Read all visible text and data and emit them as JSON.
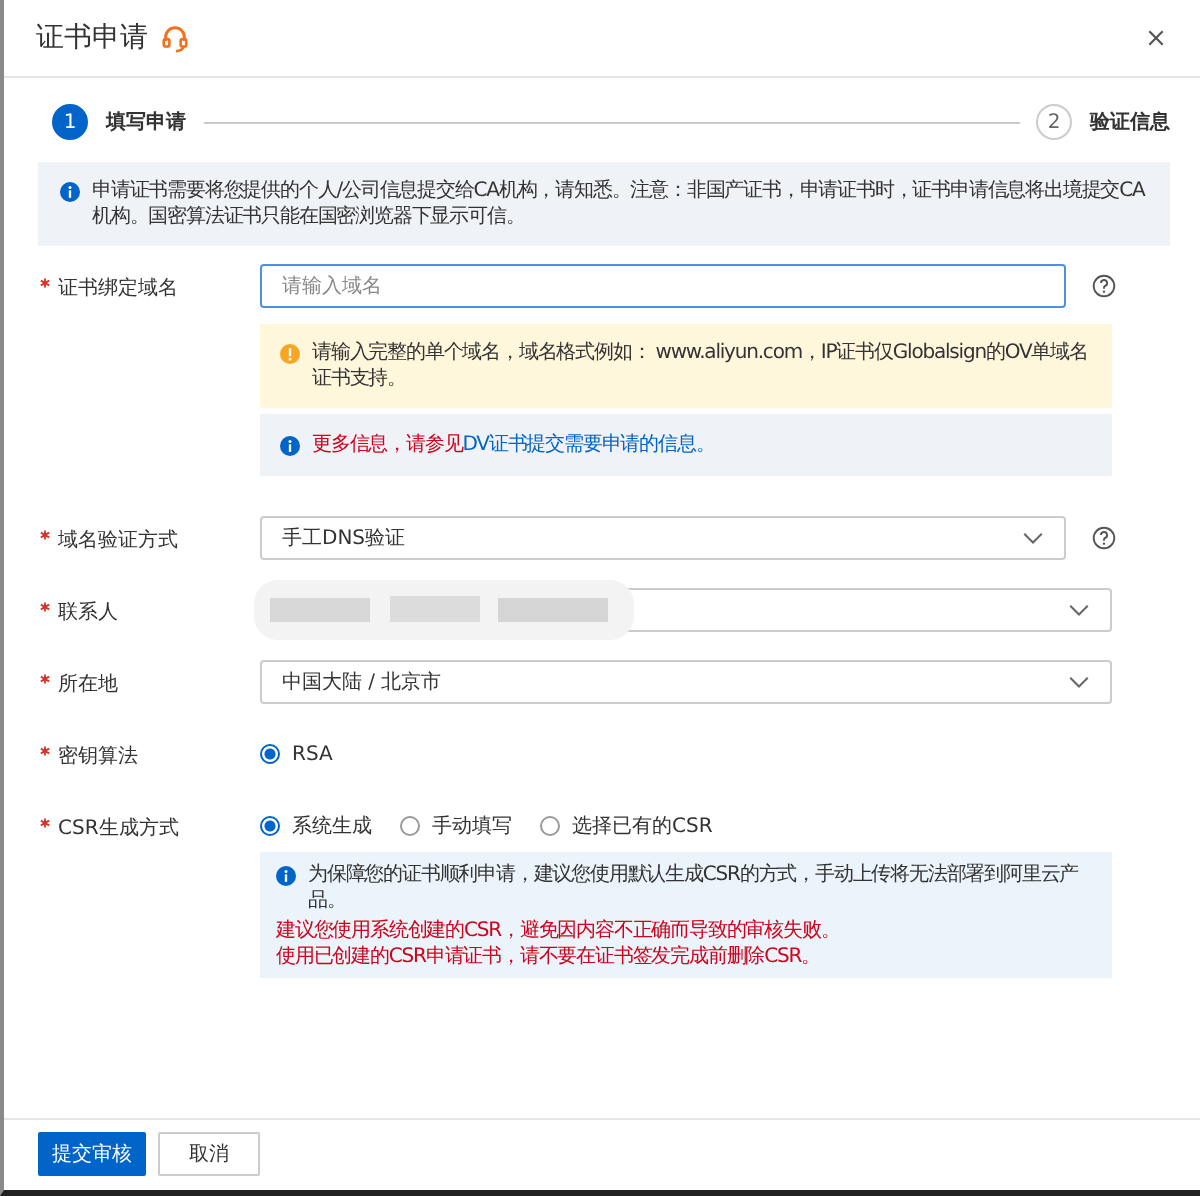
{
  "dialog": {
    "title": "证书申请",
    "steps": [
      {
        "number": "1",
        "label": "填写申请",
        "selected": true
      },
      {
        "number": "2",
        "label": "验证信息",
        "selected": false
      }
    ],
    "notice": "申请证书需要将您提供的个人/公司信息提交给CA机构，请知悉。注意：非国产证书，申请证书时，证书申请信息将出境提交CA机构。国密算法证书只能在国密浏览器下显示可信。",
    "form": [
      {
        "kind": "input",
        "label": "证书绑定域名",
        "required": true,
        "placeholder": "请输入域名",
        "help": true,
        "wide": false,
        "notices": [
          {
            "kind": "warning",
            "text": "请输入完整的单个域名，域名格式例如： www.aliyun.com，IP证书仅Globalsign的OV单域名证书支持。"
          },
          {
            "kind": "link",
            "text": "更多信息，请参见",
            "link": "DV证书提交需要申请的信息。"
          }
        ]
      },
      {
        "kind": "select",
        "label": "域名验证方式",
        "required": true,
        "value": "手工DNS验证",
        "help": true,
        "wide": false
      },
      {
        "kind": "redacted",
        "label": "联系人",
        "required": true,
        "help": false,
        "wide": true
      },
      {
        "kind": "select",
        "label": "所在地",
        "required": true,
        "value": "中国大陆 / 北京市",
        "help": false,
        "wide": true
      },
      {
        "kind": "radio",
        "label": "密钥算法",
        "required": true,
        "options": [
          {
            "label": "RSA",
            "selected": true
          }
        ]
      },
      {
        "kind": "radio",
        "label": "CSR生成方式",
        "required": true,
        "options": [
          {
            "label": "系统生成",
            "selected": true
          },
          {
            "label": "手动填写",
            "selected": false
          },
          {
            "label": "选择已有的CSR",
            "selected": false
          }
        ],
        "info": "为保障您的证书顺利申请，建议您使用默认生成CSR的方式，手动上传将无法部署到阿里云产品。",
        "warnings": [
          "建议您使用系统创建的CSR，避免因内容不正确而导致的审核失败。",
          "使用已创建的CSR申请证书，请不要在证书签发完成前删除CSR。"
        ]
      }
    ],
    "buttons": [
      {
        "label": "提交审核",
        "kind": "primary"
      },
      {
        "label": "取消",
        "kind": "secondary"
      }
    ]
  }
}
